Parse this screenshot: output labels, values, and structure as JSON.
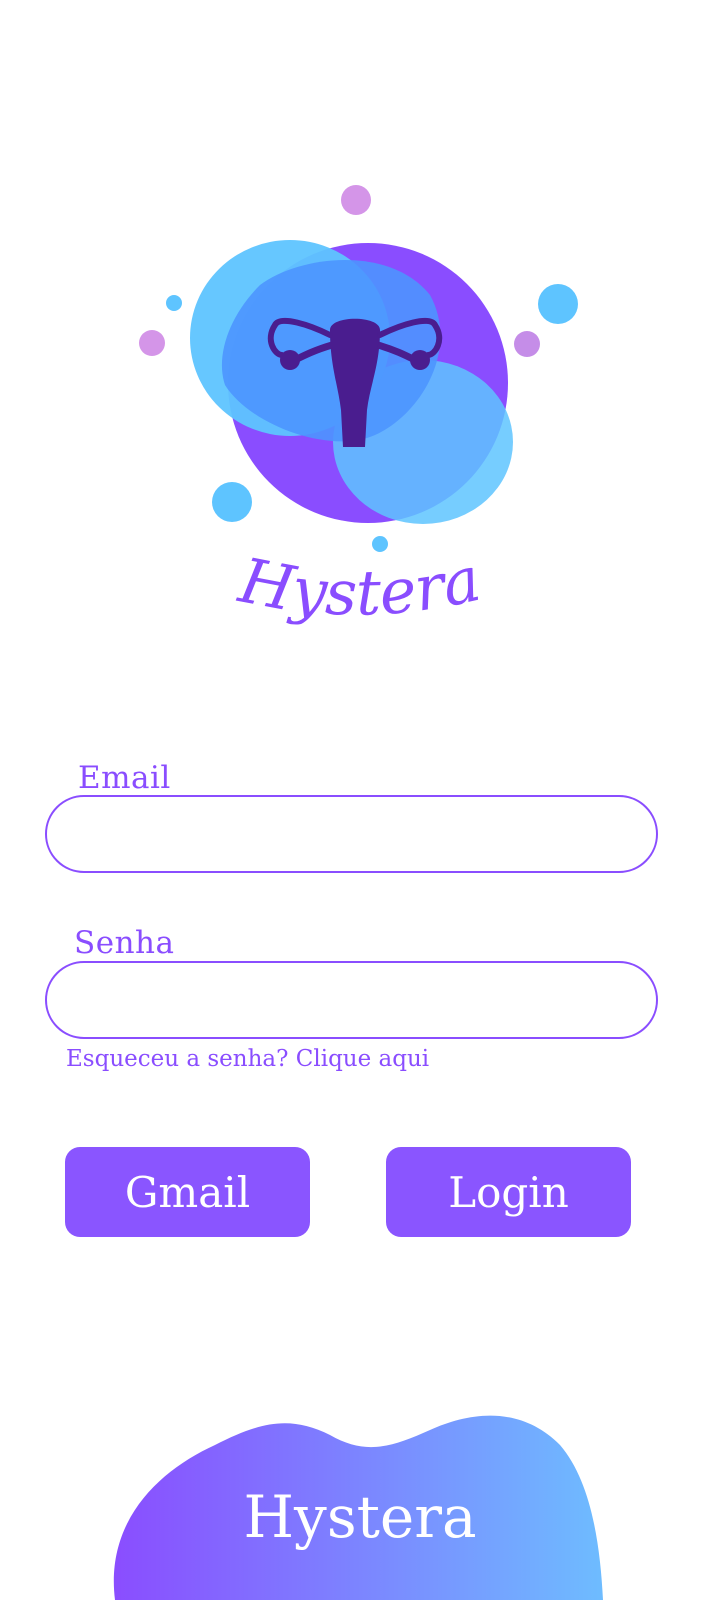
{
  "brand": {
    "logo_text": "Hystera",
    "logo_icon": "uterus-icon",
    "colors": {
      "purple": "#8a55ff",
      "light_blue": "#5ec4ff",
      "dark_purple": "#4a1d8f",
      "pink": "#d495e8"
    }
  },
  "form": {
    "email_label": "Email",
    "email_value": "",
    "password_label": "Senha",
    "password_value": "",
    "forgot_password": "Esqueceu a senha? Clique aqui"
  },
  "buttons": {
    "gmail": "Gmail",
    "login": "Login"
  },
  "footer": {
    "title": "Hystera"
  }
}
